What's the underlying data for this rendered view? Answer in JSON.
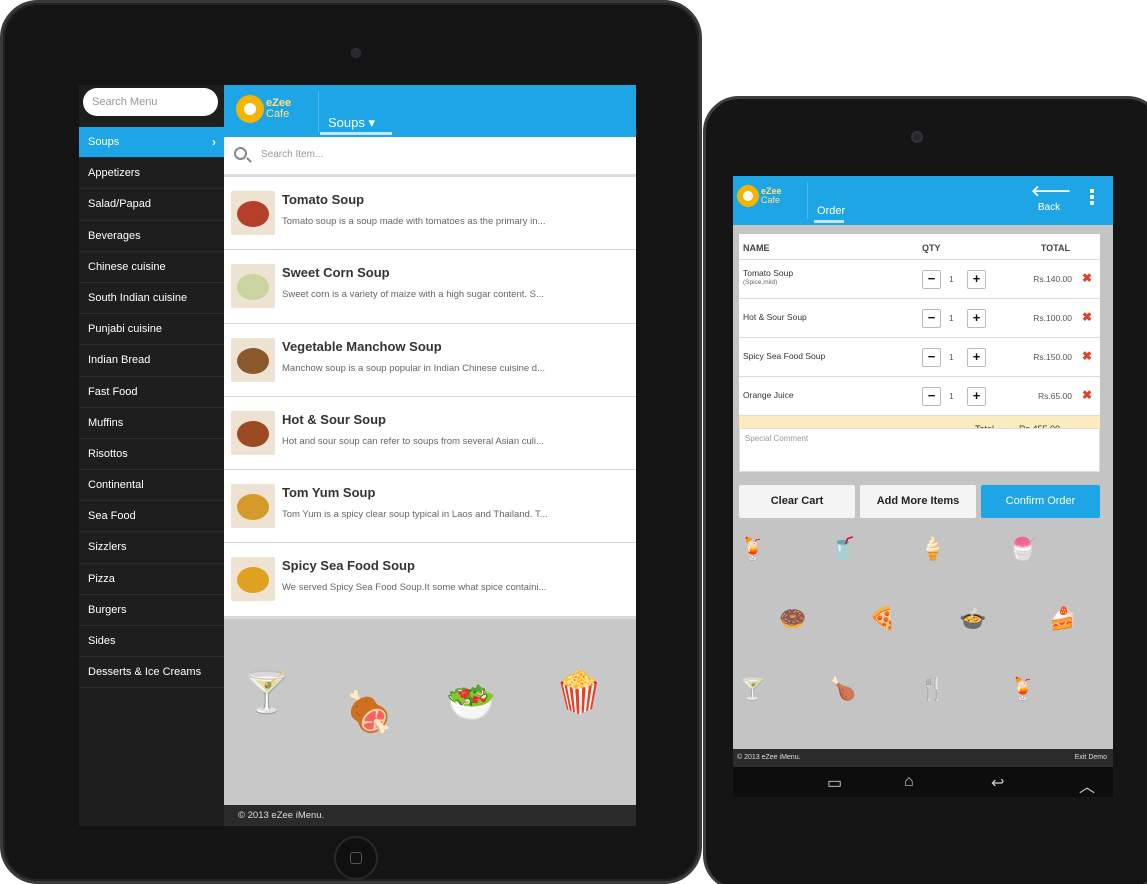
{
  "ipad": {
    "search_placeholder": "Search Menu",
    "categories": [
      {
        "label": "Soups",
        "active": true
      },
      {
        "label": "Appetizers"
      },
      {
        "label": "Salad/Papad"
      },
      {
        "label": "Beverages"
      },
      {
        "label": "Chinese cuisine"
      },
      {
        "label": "South Indian cuisine"
      },
      {
        "label": "Punjabi cuisine"
      },
      {
        "label": "Indian Bread"
      },
      {
        "label": "Fast Food"
      },
      {
        "label": "Muffins"
      },
      {
        "label": "Risottos"
      },
      {
        "label": "Continental"
      },
      {
        "label": "Sea Food"
      },
      {
        "label": "Sizzlers"
      },
      {
        "label": "Pizza"
      },
      {
        "label": "Burgers"
      },
      {
        "label": "Sides"
      },
      {
        "label": "Desserts & Ice Creams"
      }
    ],
    "logo": {
      "line1": "eZee",
      "line2": "Cafe"
    },
    "category_dropdown": "Soups ▾",
    "item_search_placeholder": "Search Item...",
    "items": [
      {
        "name": "Tomato Soup",
        "desc": "Tomato soup is a soup made with tomatoes as the primary in...",
        "color": "#b5402a"
      },
      {
        "name": "Sweet Corn Soup",
        "desc": "Sweet corn is a variety of maize with a high sugar content. S...",
        "color": "#c9d4a0"
      },
      {
        "name": "Vegetable Manchow Soup",
        "desc": "Manchow soup is a soup popular in Indian Chinese cuisine d...",
        "color": "#8a5a2a"
      },
      {
        "name": "Hot & Sour Soup",
        "desc": "Hot and sour soup can refer to soups from several Asian culi...",
        "color": "#9b4a22"
      },
      {
        "name": "Tom Yum Soup",
        "desc": "Tom Yum is a spicy clear soup typical in Laos and Thailand. T...",
        "color": "#d49a2a"
      },
      {
        "name": "Spicy Sea Food Soup",
        "desc": "We served Spicy Sea Food Soup.It some what spice containi...",
        "color": "#e0a020"
      }
    ],
    "footer": "© 2013 eZee iMenu."
  },
  "order": {
    "logo": {
      "line1": "eZee",
      "line2": "Cafe"
    },
    "tab_label": "Order",
    "back_arrow": "🡐",
    "back_label": "Back",
    "headers": {
      "name": "NAME",
      "qty": "QTY",
      "total": "TOTAL"
    },
    "rows": [
      {
        "name": "Tomato Soup",
        "sub": "(Spice,mild)",
        "qty": "1",
        "price": "Rs.140.00"
      },
      {
        "name": "Hot & Sour Soup",
        "sub": "",
        "qty": "1",
        "price": "Rs.100.00"
      },
      {
        "name": "Spicy Sea Food Soup",
        "sub": "",
        "qty": "1",
        "price": "Rs.150.00"
      },
      {
        "name": "Orange Juice",
        "sub": "",
        "qty": "1",
        "price": "Rs.65.00"
      }
    ],
    "total_label": "Total",
    "total_value": "Rs.455.00",
    "special_comment_placeholder": "Special Comment",
    "buttons": {
      "clear": "Clear Cart",
      "more": "Add More Items",
      "confirm": "Confirm Order"
    },
    "footer_left": "© 2013 eZee iMenu.",
    "footer_right": "Exit Demo"
  },
  "colors": {
    "accent": "#1ea5e6",
    "delete": "#e0412c",
    "total_bg": "#fbecbf"
  }
}
